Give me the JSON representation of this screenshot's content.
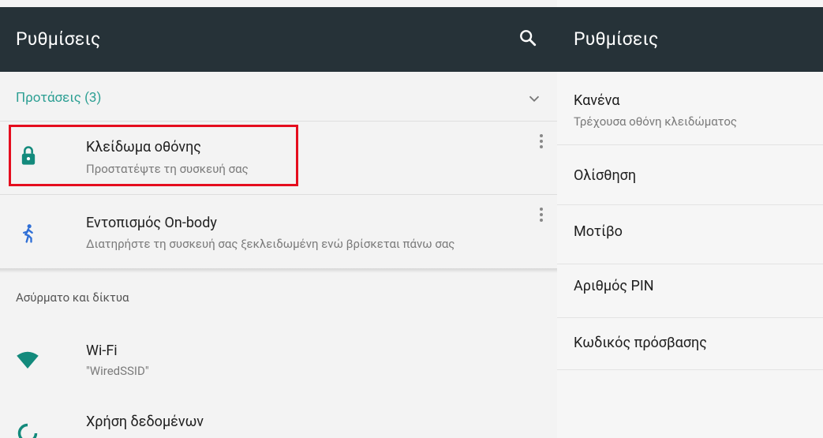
{
  "left": {
    "title": "Ρυθμίσεις",
    "search_icon": "search-icon",
    "suggestions_label": "Προτάσεις (3)",
    "suggestions": [
      {
        "title": "Κλείδωμα οθόνης",
        "subtitle": "Προστατέψτε τη συσκευή σας",
        "icon": "lock-icon"
      },
      {
        "title": "Εντοπισμός On-body",
        "subtitle": "Διατηρήστε τη συσκευή σας ξεκλειδωμένη ενώ βρίσκεται πάνω σας",
        "icon": "person-walking-icon"
      }
    ],
    "section_title": "Ασύρματο και δίκτυα",
    "items": [
      {
        "title": "Wi-Fi",
        "subtitle": "\"WiredSSID\"",
        "icon": "wifi-icon"
      },
      {
        "title": "Χρήση δεδομένων",
        "icon": "data-usage-icon"
      }
    ]
  },
  "right": {
    "title": "Ρυθμίσεις",
    "options": [
      {
        "title": "Κανένα",
        "subtitle": "Τρέχουσα οθόνη κλειδώματος"
      },
      {
        "title": "Ολίσθηση"
      },
      {
        "title": "Μοτίβο"
      },
      {
        "title": "Αριθμός PIN"
      },
      {
        "title": "Κωδικός πρόσβασης"
      }
    ]
  },
  "colors": {
    "appbar": "#263238",
    "accent": "#2c9f93",
    "icon_teal": "#138a7c",
    "icon_blue": "#2f6fd6",
    "highlight": "#e50d1e"
  }
}
